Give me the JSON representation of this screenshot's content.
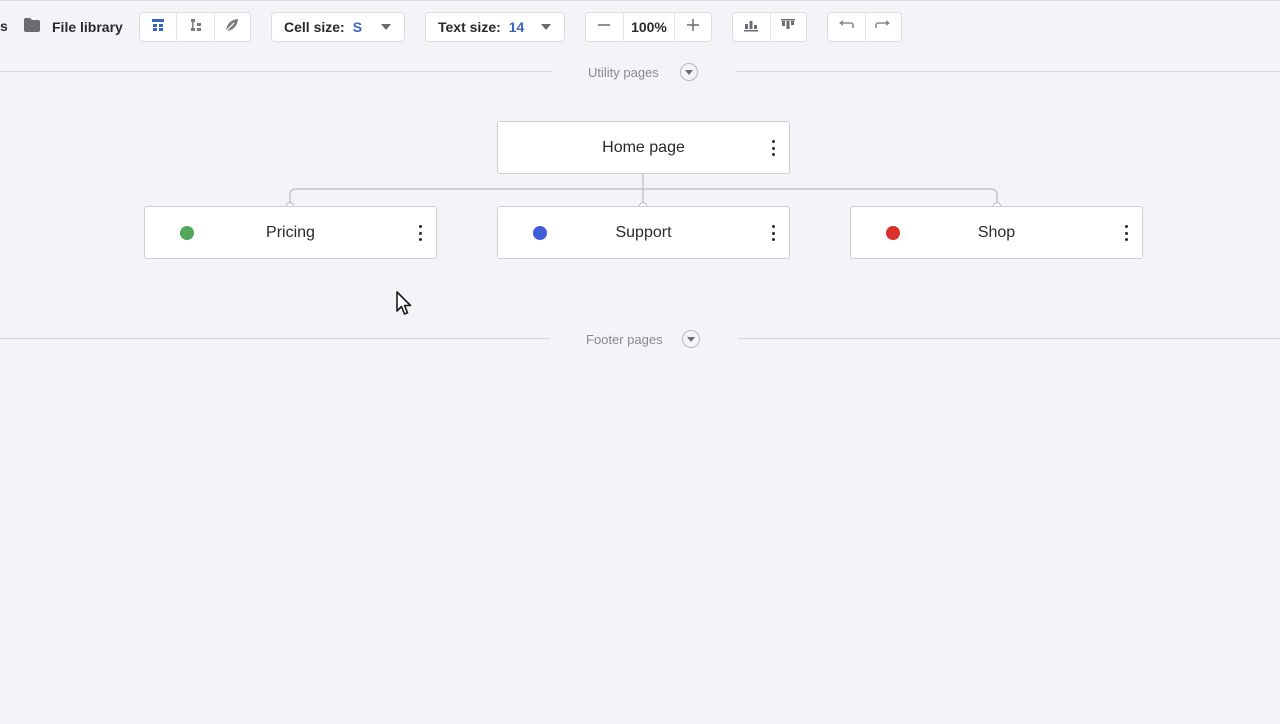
{
  "toolbar": {
    "truncated_label": "s",
    "file_library": {
      "icon": "folder-icon",
      "label": "File library"
    },
    "view_modes": [
      {
        "icon": "tree-view-icon",
        "active": true
      },
      {
        "icon": "list-view-icon",
        "active": false
      },
      {
        "icon": "leaf-icon",
        "active": false
      }
    ],
    "cell_size": {
      "label": "Cell size:",
      "value": "S"
    },
    "text_size": {
      "label": "Text size:",
      "value": "14"
    },
    "zoom": {
      "value": "100%"
    },
    "align_buttons": [
      "align-bottom-icon",
      "align-top-icon"
    ],
    "history": [
      "undo-icon",
      "redo-icon"
    ]
  },
  "sections": {
    "utility": {
      "label": "Utility pages"
    },
    "footer": {
      "label": "Footer pages"
    }
  },
  "sitemap": {
    "root": {
      "title": "Home page"
    },
    "children": [
      {
        "title": "Pricing",
        "color": "#52a75a"
      },
      {
        "title": "Support",
        "color": "#3f5fd8"
      },
      {
        "title": "Shop",
        "color": "#d93129"
      }
    ]
  },
  "colors": {
    "accent": "#3b63c4",
    "background": "#f4f4f8"
  }
}
